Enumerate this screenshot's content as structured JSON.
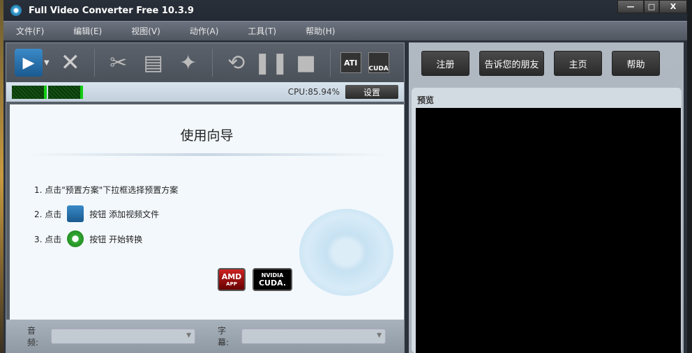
{
  "window": {
    "title": "Full Video Converter Free 10.3.9",
    "minimize": "—",
    "maximize": "□",
    "close": "X"
  },
  "menu": [
    "文件(F)",
    "编辑(E)",
    "视图(V)",
    "动作(A)",
    "工具(T)",
    "帮助(H)"
  ],
  "status": {
    "cpu": "CPU:85.94%",
    "settings": "设置"
  },
  "guide": {
    "title": "使用向导",
    "step1": "1. 点击\"预置方案\"下拉框选择预置方案",
    "step2a": "2. 点击",
    "step2b": "按钮 添加视频文件",
    "step3a": "3. 点击",
    "step3b": "按钮 开始转换",
    "amd": "AMD",
    "amd_sub": "APP",
    "nvidia": "NVIDIA",
    "cuda": "CUDA."
  },
  "bottom": {
    "audio": "音频:",
    "subtitle": "字幕:"
  },
  "right": {
    "buttons": [
      "注册",
      "告诉您的朋友",
      "主页",
      "帮助"
    ],
    "preview": "预览"
  },
  "toolbar": {
    "ati": "ATI",
    "cuda": "CUDA"
  }
}
